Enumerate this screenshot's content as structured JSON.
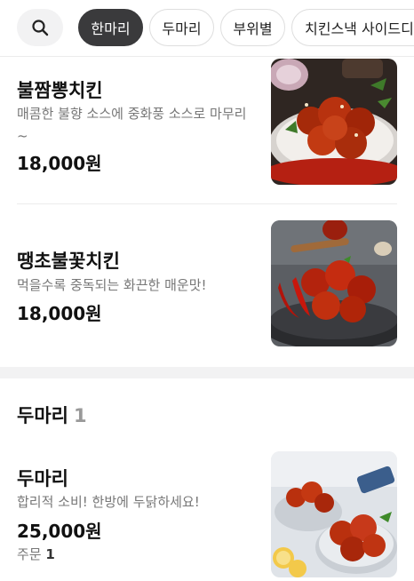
{
  "category_bar": {
    "search_icon": "search-icon",
    "chips": [
      {
        "label": "한마리",
        "active": true
      },
      {
        "label": "두마리",
        "active": false
      },
      {
        "label": "부위별",
        "active": false
      },
      {
        "label": "치킨스낵 사이드디쉬",
        "active": false
      }
    ]
  },
  "section_single": {
    "items": [
      {
        "name": "불짬뽕치킨",
        "description_line1": "매콤한 불향 소스에 중화풍 소스로 마무리",
        "description_line2": "~",
        "price": "18,000원"
      },
      {
        "name": "땡초불꽃치킨",
        "description_line1": "먹을수록 중독되는 화끈한 매운맛!",
        "price": "18,000원"
      }
    ]
  },
  "section_double": {
    "title": "두마리",
    "count": "1",
    "items": [
      {
        "name": "두마리",
        "description_line1": "합리적 소비! 한방에 두닭하세요!",
        "price": "25,000원",
        "orders_label": "주문",
        "orders_count": "1"
      }
    ]
  },
  "colors": {
    "active_chip": "#3a3a3c",
    "sauce_red": "#b8220e",
    "section_gap": "#f2f2f3"
  }
}
